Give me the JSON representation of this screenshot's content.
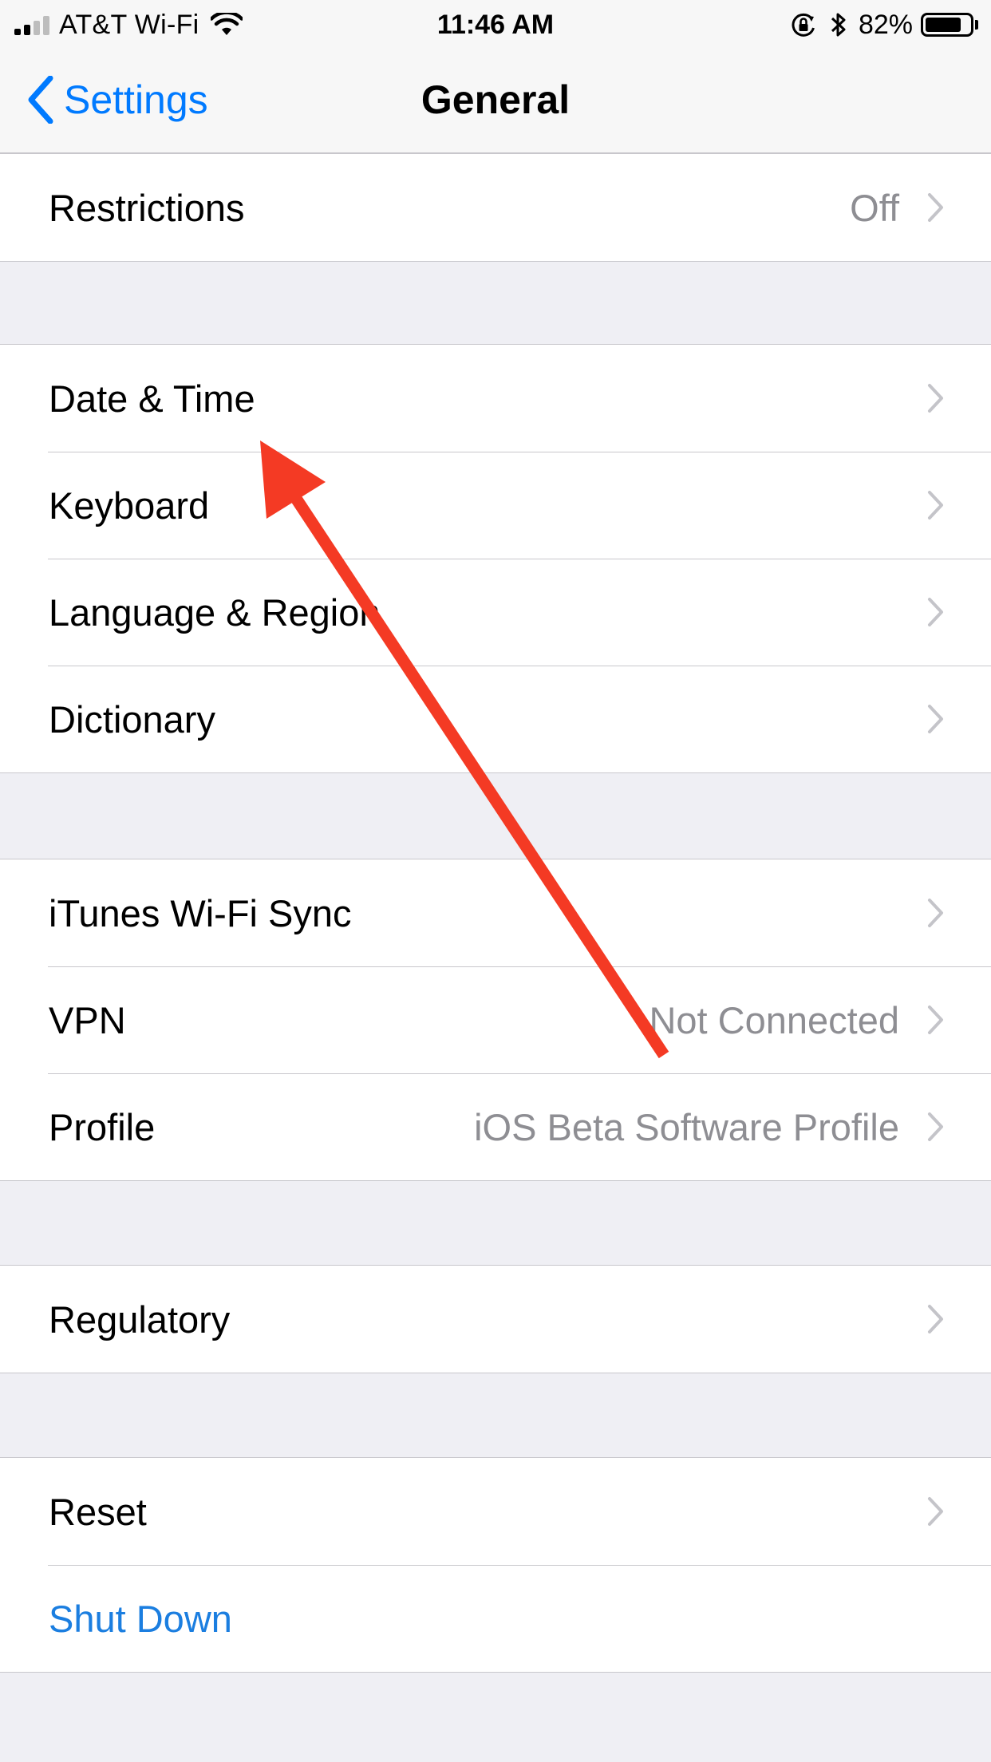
{
  "status_bar": {
    "carrier": "AT&T Wi-Fi",
    "time": "11:46 AM",
    "battery": "82%",
    "battery_level": 0.82,
    "icons": [
      "signal-bars-icon",
      "wifi-icon",
      "orientation-lock-icon",
      "bluetooth-icon",
      "battery-icon"
    ]
  },
  "nav": {
    "back_label": "Settings",
    "title": "General"
  },
  "groups": [
    {
      "rows": [
        {
          "label": "Restrictions",
          "value": "Off"
        }
      ]
    },
    {
      "rows": [
        {
          "label": "Date & Time"
        },
        {
          "label": "Keyboard"
        },
        {
          "label": "Language & Region"
        },
        {
          "label": "Dictionary"
        }
      ]
    },
    {
      "rows": [
        {
          "label": "iTunes Wi-Fi Sync"
        },
        {
          "label": "VPN",
          "value": "Not Connected"
        },
        {
          "label": "Profile",
          "value": "iOS Beta Software Profile"
        }
      ]
    },
    {
      "rows": [
        {
          "label": "Regulatory"
        }
      ]
    },
    {
      "rows": [
        {
          "label": "Reset"
        },
        {
          "label": "Shut Down"
        }
      ]
    }
  ],
  "colors": {
    "accent": "#007aff",
    "shutdown_text": "#1b7ee0",
    "annotation_arrow": "#f43a24",
    "secondary_text": "#8e8e93",
    "chevron": "#c4c4c9",
    "grouped_background": "#efeff4"
  }
}
